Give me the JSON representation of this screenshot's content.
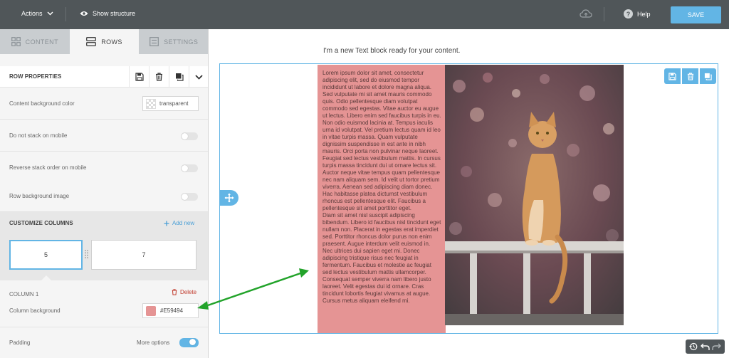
{
  "topbar": {
    "actions_label": "Actions",
    "show_structure_label": "Show structure",
    "help_label": "Help",
    "save_label": "SAVE"
  },
  "tabs": [
    {
      "label": "CONTENT",
      "icon": "grid-icon",
      "active": false
    },
    {
      "label": "ROWS",
      "icon": "rows-icon",
      "active": true
    },
    {
      "label": "SETTINGS",
      "icon": "settings-icon",
      "active": false
    }
  ],
  "row_properties": {
    "title": "ROW PROPERTIES",
    "content_bg_label": "Content background color",
    "content_bg_value": "transparent",
    "no_stack_label": "Do not stack on mobile",
    "reverse_stack_label": "Reverse stack order on mobile",
    "row_bg_image_label": "Row background image"
  },
  "customize_columns": {
    "title": "CUSTOMIZE COLUMNS",
    "add_new_label": "Add new",
    "columns": [
      "5",
      "7"
    ]
  },
  "column1": {
    "title": "COLUMN 1",
    "delete_label": "Delete",
    "bg_label": "Column background",
    "bg_value": "#E59494",
    "bg_color": "#E59494"
  },
  "padding": {
    "label": "Padding",
    "more_options_label": "More options",
    "more_options_on": true
  },
  "canvas": {
    "text_block": "I'm a new Text block ready for your content.",
    "lorem": "Lorem ipsum dolor sit amet, consectetur adipiscing elit, sed do eiusmod tempor incididunt ut labore et dolore magna aliqua. Sed vulputate mi sit amet mauris commodo quis. Odio pellentesque diam volutpat commodo sed egestas. Vitae auctor eu augue ut lectus. Libero enim sed faucibus turpis in eu. Non odio euismod lacinia at. Tempus iaculis urna id volutpat. Vel pretium lectus quam id leo in vitae turpis massa. Quam vulputate dignissim suspendisse in est ante in nibh mauris. Orci porta non pulvinar neque laoreet. Feugiat sed lectus vestibulum mattis. In cursus turpis massa tincidunt dui ut ornare lectus sit. Auctor neque vitae tempus quam pellentesque nec nam aliquam sem. Id velit ut tortor pretium viverra. Aenean sed adipiscing diam donec. Hac habitasse platea dictumst vestibulum rhoncus est pellentesque elit. Faucibus a pellentesque sit amet porttitor eget.\nDiam sit amet nisl suscipit adipiscing bibendum. Libero id faucibus nisl tincidunt eget nullam non. Placerat in egestas erat imperdiet sed. Porttitor rhoncus dolor purus non enim praesent. Augue interdum velit euismod in. Nec ultrices dui sapien eget mi. Donec adipiscing tristique risus nec feugiat in fermentum. Faucibus et molestie ac feugiat sed lectus vestibulum mattis ullamcorper. Consequat semper viverra nam libero justo laoreet. Velit egestas dui id ornare. Cras tincidunt lobortis feugiat vivamus at augue. Cursus metus aliquam eleifend mi."
  },
  "colors": {
    "accent": "#62B5E5",
    "topbar": "#505659",
    "delete": "#C0392B",
    "annotation_arrow": "#22A32A"
  }
}
